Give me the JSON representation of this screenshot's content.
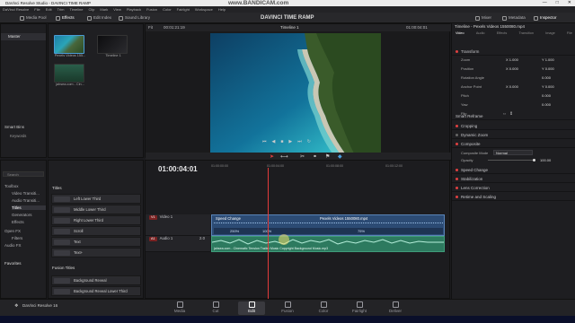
{
  "window": {
    "title": "DaVinci Resolve Studio - DAVINCI TIME RAMP",
    "controls": [
      "—",
      "□",
      "✕"
    ]
  },
  "watermark": "www.BANDICAM.com",
  "menu": [
    "DaVinci Resolve",
    "File",
    "Edit",
    "Trim",
    "Timeline",
    "Clip",
    "Mark",
    "View",
    "Playback",
    "Fusion",
    "Color",
    "Fairlight",
    "Workspace",
    "Help"
  ],
  "toolbar": {
    "media_pool": "Media Pool",
    "effects": "Effects",
    "edit_index": "Edit Index",
    "sound_library": "Sound Library",
    "project_title": "DAVINCI TIME RAMP",
    "mixer": "Mixer",
    "metadata": "Metadata",
    "inspector": "Inspector"
  },
  "bins": {
    "master": "Master",
    "smart_bins": "Smart Bins",
    "keywords": "Keywords"
  },
  "pool_clips": [
    {
      "name": "Pexels Videos 155..."
    },
    {
      "name": "Timeline 1"
    },
    {
      "name": "jahsea.com - Cin..."
    }
  ],
  "viewer": {
    "zoom": "Fit",
    "source_tc": "00:01:21:19",
    "timeline_name": "Timeline 1",
    "record_tc": "01:00:04:01"
  },
  "inspector": {
    "header": "Timeline - Pexels Videos 1550080.mp4",
    "tabs": [
      "Video",
      "Audio",
      "Effects",
      "Transition",
      "Image",
      "File"
    ],
    "transform": "Transform",
    "zoom_label": "Zoom",
    "zoom_x": "X 1.000",
    "zoom_y": "Y 1.000",
    "position_label": "Position",
    "position_x": "X 0.000",
    "position_y": "Y 0.000",
    "rotation_label": "Rotation Angle",
    "rotation_val": "0.000",
    "anchor_label": "Anchor Point",
    "anchor_x": "X 0.000",
    "anchor_y": "Y 0.000",
    "pitch_label": "Pitch",
    "pitch_val": "0.000",
    "yaw_label": "Yaw",
    "yaw_val": "0.000",
    "flip_label": "Flip",
    "smart_reframe": "Smart Reframe",
    "cropping": "Cropping",
    "dynamic_zoom": "Dynamic Zoom",
    "composite": "Composite",
    "composite_mode_label": "Composite Mode",
    "composite_mode_val": "Normal",
    "opacity_label": "Opacity",
    "opacity_val": "100.00",
    "opacity_level": 100,
    "speed_change": "Speed Change",
    "stabilization": "Stabilization",
    "lens_correction": "Lens Correction",
    "retime_scaling": "Retime and Scaling"
  },
  "fx_tree": {
    "search": "Search",
    "items": [
      "Toolbox",
      "Video Transiti...",
      "Audio Transiti...",
      "Titles",
      "Generators",
      "Effects",
      "Open FX",
      "Filters",
      "Audio FX"
    ],
    "favorites": "Favorites"
  },
  "fx_list": {
    "titles_header": "Titles",
    "items": [
      "Left Lower Third",
      "Middle Lower Third",
      "Right Lower Third",
      "Scroll",
      "Text",
      "Text+"
    ],
    "fusion_header": "Fusion Titles",
    "fusion_items": [
      "Background Reveal",
      "Background Reveal Lower Third"
    ]
  },
  "timeline": {
    "timecode": "01:00:04:01",
    "ruler": [
      "01:00:00:00",
      "01:00:04:00",
      "01:00:08:00",
      "01:00:12:00"
    ],
    "video_track_badge": "V1",
    "video_track": "Video 1",
    "audio_track_badge": "A1",
    "audio_track": "Audio 1",
    "audio_track_ch": "2.0",
    "speed_change_label": "Speed Change",
    "video_clip": "Pexels Videos 1550080.mp4",
    "speed_1": "250%",
    "speed_2": "100%",
    "speed_3": "75%",
    "audio_clip": "jahsea.com - Cinematic Tension Trailer Music Copyright Background Music.mp3"
  },
  "pages": [
    "Media",
    "Cut",
    "Edit",
    "Fusion",
    "Color",
    "Fairlight",
    "Deliver"
  ],
  "active_page": "Edit",
  "app_name": "DaVinci Resolve 16"
}
